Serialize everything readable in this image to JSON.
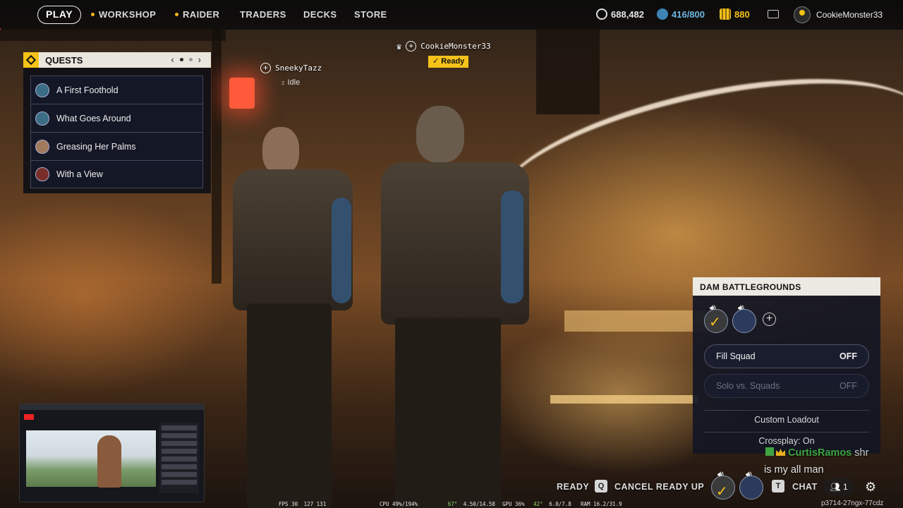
{
  "topbar": {
    "play_label": "PLAY",
    "nav": [
      {
        "label": "WORKSHOP",
        "dot": true
      },
      {
        "label": "RAIDER",
        "dot": true
      },
      {
        "label": "TRADERS",
        "dot": false
      },
      {
        "label": "DECKS",
        "dot": false
      },
      {
        "label": "STORE",
        "dot": false
      }
    ],
    "currencies": [
      {
        "icon": "coins-icon",
        "value": "688,482",
        "color": "#e6e6e6"
      },
      {
        "icon": "capacity-icon",
        "value": "416/800",
        "color": "#6fb7e3"
      },
      {
        "icon": "premium-currency-icon",
        "value": "880",
        "color": "#f5c21a"
      }
    ],
    "username": "CookieMonster33"
  },
  "quests": {
    "title": "QUESTS",
    "items": [
      {
        "label": "A First Foothold"
      },
      {
        "label": "What Goes Around"
      },
      {
        "label": "Greasing Her Palms"
      },
      {
        "label": "With a View"
      }
    ]
  },
  "players": {
    "leader": {
      "name": "CookieMonster33",
      "status": "Ready"
    },
    "member": {
      "name": "SneekyTazz",
      "status": "Idle"
    }
  },
  "squad": {
    "title": "DAM BATTLEGROUNDS",
    "fill_squad": {
      "label": "Fill Squad",
      "value": "OFF"
    },
    "solo_vs_squads": {
      "label": "Solo vs. Squads",
      "value": "OFF"
    },
    "custom_loadout": "Custom Loadout",
    "crossplay": "Crossplay: On"
  },
  "chat_overlay": {
    "name": "CurtisRamos",
    "name_suffix": "shr",
    "message": "is my all man"
  },
  "bottombar": {
    "ready_label": "READY",
    "cancel_key": "Q",
    "cancel_label": "CANCEL READY UP",
    "chat_key": "T",
    "chat_label": "CHAT",
    "friends_count": "1"
  },
  "osd": {
    "fps": "FPS 30",
    "frametime": "127 131",
    "cpu": "CPU 49%/194%",
    "cpu_temp": "67°",
    "cpu_freq": "4.50/14.58",
    "gpu": "GPU 36%",
    "gpu_temp": "42°",
    "vram": "6.0/7.8",
    "ram": "RAM 16.2/31.9"
  },
  "lobby_code": "p3714-27ngx-77cdz",
  "colors": {
    "accent": "#f5c21a",
    "chat_green": "#3fa542"
  }
}
